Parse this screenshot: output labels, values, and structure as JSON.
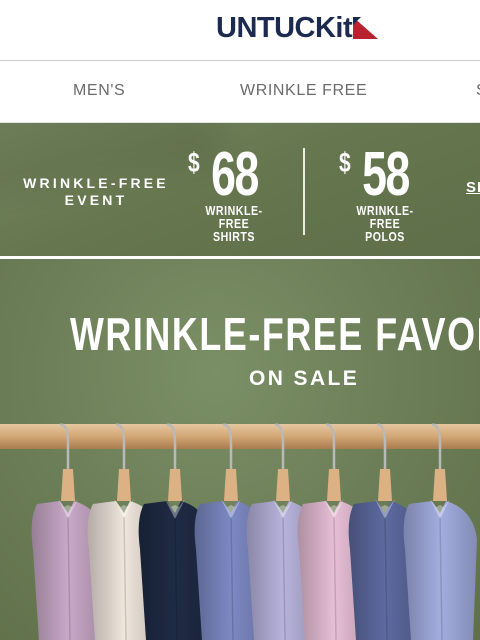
{
  "header": {
    "logo_text": "UNTUCKit",
    "logo_accent_color": "#b8232f",
    "logo_text_color": "#1c2a4f"
  },
  "nav": {
    "items": [
      {
        "label": "MEN'S"
      },
      {
        "label": "WRINKLE FREE"
      },
      {
        "label": "S"
      }
    ]
  },
  "promo": {
    "event_label": "WRINKLE-FREE EVENT",
    "offers": [
      {
        "dollar": "$",
        "amount": "68",
        "caption_line1": "WRINKLE-FREE",
        "caption_line2": "SHIRTS"
      },
      {
        "dollar": "$",
        "amount": "58",
        "caption_line1": "WRINKLE-FREE",
        "caption_line2": "POLOS"
      }
    ],
    "cta_label": "SH",
    "background_color": "#6b7c55"
  },
  "hero": {
    "title": "WRINKLE-FREE FAVORITES",
    "subtitle": "ON SALE",
    "shirt_colors": [
      "#c9a9c8",
      "#efe6dc",
      "#1f2b45",
      "#7d89c4",
      "#b8b3dc",
      "#e7bfd6",
      "#5d6aa0",
      "#a3aee0"
    ]
  }
}
